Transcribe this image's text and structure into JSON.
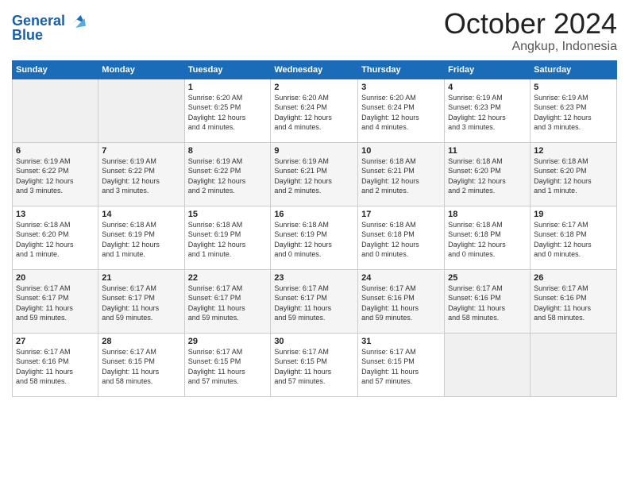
{
  "header": {
    "logo_line1": "General",
    "logo_line2": "Blue",
    "month": "October 2024",
    "location": "Angkup, Indonesia"
  },
  "weekdays": [
    "Sunday",
    "Monday",
    "Tuesday",
    "Wednesday",
    "Thursday",
    "Friday",
    "Saturday"
  ],
  "weeks": [
    [
      {
        "day": "",
        "info": ""
      },
      {
        "day": "",
        "info": ""
      },
      {
        "day": "1",
        "info": "Sunrise: 6:20 AM\nSunset: 6:25 PM\nDaylight: 12 hours\nand 4 minutes."
      },
      {
        "day": "2",
        "info": "Sunrise: 6:20 AM\nSunset: 6:24 PM\nDaylight: 12 hours\nand 4 minutes."
      },
      {
        "day": "3",
        "info": "Sunrise: 6:20 AM\nSunset: 6:24 PM\nDaylight: 12 hours\nand 4 minutes."
      },
      {
        "day": "4",
        "info": "Sunrise: 6:19 AM\nSunset: 6:23 PM\nDaylight: 12 hours\nand 3 minutes."
      },
      {
        "day": "5",
        "info": "Sunrise: 6:19 AM\nSunset: 6:23 PM\nDaylight: 12 hours\nand 3 minutes."
      }
    ],
    [
      {
        "day": "6",
        "info": "Sunrise: 6:19 AM\nSunset: 6:22 PM\nDaylight: 12 hours\nand 3 minutes."
      },
      {
        "day": "7",
        "info": "Sunrise: 6:19 AM\nSunset: 6:22 PM\nDaylight: 12 hours\nand 3 minutes."
      },
      {
        "day": "8",
        "info": "Sunrise: 6:19 AM\nSunset: 6:22 PM\nDaylight: 12 hours\nand 2 minutes."
      },
      {
        "day": "9",
        "info": "Sunrise: 6:19 AM\nSunset: 6:21 PM\nDaylight: 12 hours\nand 2 minutes."
      },
      {
        "day": "10",
        "info": "Sunrise: 6:18 AM\nSunset: 6:21 PM\nDaylight: 12 hours\nand 2 minutes."
      },
      {
        "day": "11",
        "info": "Sunrise: 6:18 AM\nSunset: 6:20 PM\nDaylight: 12 hours\nand 2 minutes."
      },
      {
        "day": "12",
        "info": "Sunrise: 6:18 AM\nSunset: 6:20 PM\nDaylight: 12 hours\nand 1 minute."
      }
    ],
    [
      {
        "day": "13",
        "info": "Sunrise: 6:18 AM\nSunset: 6:20 PM\nDaylight: 12 hours\nand 1 minute."
      },
      {
        "day": "14",
        "info": "Sunrise: 6:18 AM\nSunset: 6:19 PM\nDaylight: 12 hours\nand 1 minute."
      },
      {
        "day": "15",
        "info": "Sunrise: 6:18 AM\nSunset: 6:19 PM\nDaylight: 12 hours\nand 1 minute."
      },
      {
        "day": "16",
        "info": "Sunrise: 6:18 AM\nSunset: 6:19 PM\nDaylight: 12 hours\nand 0 minutes."
      },
      {
        "day": "17",
        "info": "Sunrise: 6:18 AM\nSunset: 6:18 PM\nDaylight: 12 hours\nand 0 minutes."
      },
      {
        "day": "18",
        "info": "Sunrise: 6:18 AM\nSunset: 6:18 PM\nDaylight: 12 hours\nand 0 minutes."
      },
      {
        "day": "19",
        "info": "Sunrise: 6:17 AM\nSunset: 6:18 PM\nDaylight: 12 hours\nand 0 minutes."
      }
    ],
    [
      {
        "day": "20",
        "info": "Sunrise: 6:17 AM\nSunset: 6:17 PM\nDaylight: 11 hours\nand 59 minutes."
      },
      {
        "day": "21",
        "info": "Sunrise: 6:17 AM\nSunset: 6:17 PM\nDaylight: 11 hours\nand 59 minutes."
      },
      {
        "day": "22",
        "info": "Sunrise: 6:17 AM\nSunset: 6:17 PM\nDaylight: 11 hours\nand 59 minutes."
      },
      {
        "day": "23",
        "info": "Sunrise: 6:17 AM\nSunset: 6:17 PM\nDaylight: 11 hours\nand 59 minutes."
      },
      {
        "day": "24",
        "info": "Sunrise: 6:17 AM\nSunset: 6:16 PM\nDaylight: 11 hours\nand 59 minutes."
      },
      {
        "day": "25",
        "info": "Sunrise: 6:17 AM\nSunset: 6:16 PM\nDaylight: 11 hours\nand 58 minutes."
      },
      {
        "day": "26",
        "info": "Sunrise: 6:17 AM\nSunset: 6:16 PM\nDaylight: 11 hours\nand 58 minutes."
      }
    ],
    [
      {
        "day": "27",
        "info": "Sunrise: 6:17 AM\nSunset: 6:16 PM\nDaylight: 11 hours\nand 58 minutes."
      },
      {
        "day": "28",
        "info": "Sunrise: 6:17 AM\nSunset: 6:15 PM\nDaylight: 11 hours\nand 58 minutes."
      },
      {
        "day": "29",
        "info": "Sunrise: 6:17 AM\nSunset: 6:15 PM\nDaylight: 11 hours\nand 57 minutes."
      },
      {
        "day": "30",
        "info": "Sunrise: 6:17 AM\nSunset: 6:15 PM\nDaylight: 11 hours\nand 57 minutes."
      },
      {
        "day": "31",
        "info": "Sunrise: 6:17 AM\nSunset: 6:15 PM\nDaylight: 11 hours\nand 57 minutes."
      },
      {
        "day": "",
        "info": ""
      },
      {
        "day": "",
        "info": ""
      }
    ]
  ]
}
